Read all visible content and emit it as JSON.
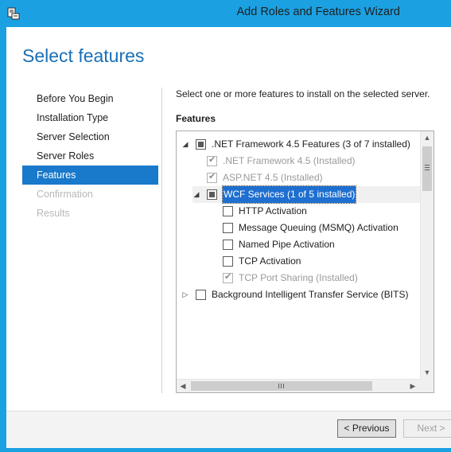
{
  "window": {
    "title": "Add Roles and Features Wizard",
    "accent_color": "#1ba1e2",
    "icon": "server-manager-icon"
  },
  "page": {
    "title": "Select features",
    "instruction": "Select one or more features to install on the selected server.",
    "features_label": "Features"
  },
  "nav": {
    "items": [
      {
        "label": "Before You Begin",
        "state": "normal"
      },
      {
        "label": "Installation Type",
        "state": "normal"
      },
      {
        "label": "Server Selection",
        "state": "normal"
      },
      {
        "label": "Server Roles",
        "state": "normal"
      },
      {
        "label": "Features",
        "state": "active"
      },
      {
        "label": "Confirmation",
        "state": "disabled"
      },
      {
        "label": "Results",
        "state": "disabled"
      }
    ]
  },
  "tree": {
    "items": [
      {
        "label": ".NET Framework 4.5 Features (3 of 7 installed)",
        "level": 0,
        "expander": "expanded",
        "checkbox": "partial",
        "installed": false
      },
      {
        "label": ".NET Framework 4.5 (Installed)",
        "level": 1,
        "expander": "none",
        "checkbox": "checked",
        "installed": true
      },
      {
        "label": "ASP.NET 4.5 (Installed)",
        "level": 1,
        "expander": "none",
        "checkbox": "checked",
        "installed": true
      },
      {
        "label": "WCF Services (1 of 5 installed)",
        "level": 1,
        "expander": "expanded",
        "checkbox": "partial",
        "installed": false,
        "selected": true
      },
      {
        "label": "HTTP Activation",
        "level": 2,
        "expander": "none",
        "checkbox": "unchecked",
        "installed": false
      },
      {
        "label": "Message Queuing (MSMQ) Activation",
        "level": 2,
        "expander": "none",
        "checkbox": "unchecked",
        "installed": false
      },
      {
        "label": "Named Pipe Activation",
        "level": 2,
        "expander": "none",
        "checkbox": "unchecked",
        "installed": false
      },
      {
        "label": "TCP Activation",
        "level": 2,
        "expander": "none",
        "checkbox": "unchecked",
        "installed": false
      },
      {
        "label": "TCP Port Sharing (Installed)",
        "level": 2,
        "expander": "none",
        "checkbox": "checked",
        "installed": true
      },
      {
        "label": "Background Intelligent Transfer Service (BITS)",
        "level": 0,
        "expander": "collapsed",
        "checkbox": "unchecked",
        "installed": false
      }
    ]
  },
  "buttons": {
    "previous": "< Previous",
    "next": "Next >"
  }
}
